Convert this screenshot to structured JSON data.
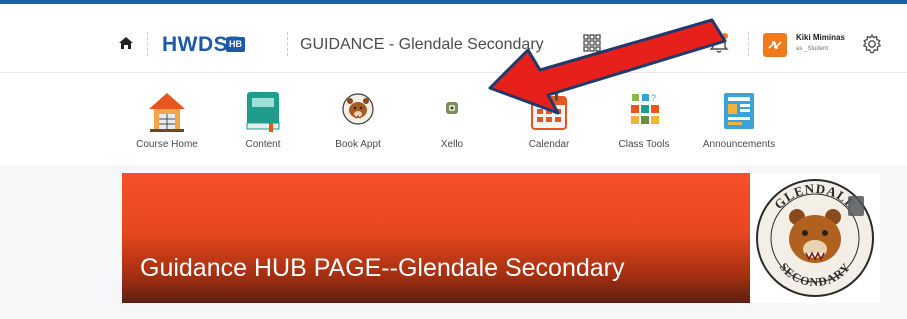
{
  "header": {
    "logo_text": "HWDSB",
    "logo_badge": "HB",
    "course_title": "GUIDANCE - Glendale Secondary",
    "user_name": "Kiki Miminas",
    "user_role": "as _Student",
    "colors": {
      "brand": "#1c5aa6",
      "avatar": "#f07a1b",
      "alert_dot": "#f07a1b"
    }
  },
  "nav": {
    "items": [
      {
        "label": "Course Home",
        "icon": "house-icon"
      },
      {
        "label": "Content",
        "icon": "book-icon"
      },
      {
        "label": "Book Appt",
        "icon": "bear-mascot-icon"
      },
      {
        "label": "Xello",
        "icon": "xello-icon"
      },
      {
        "label": "Calendar",
        "icon": "calendar-icon"
      },
      {
        "label": "Class Tools",
        "icon": "class-tools-icon"
      },
      {
        "label": "Announcements",
        "icon": "announcements-icon"
      }
    ]
  },
  "banner": {
    "title": "Guidance HUB PAGE--Glendale Secondary",
    "seal_text_top": "GLENDALE",
    "seal_text_bottom": "SECONDARY",
    "colors": {
      "banner_top": "#f5502a",
      "banner_bottom": "#5c2010"
    }
  },
  "annotation": {
    "arrow_color": "#e8201c",
    "arrow_outline": "#1f3a6b"
  }
}
